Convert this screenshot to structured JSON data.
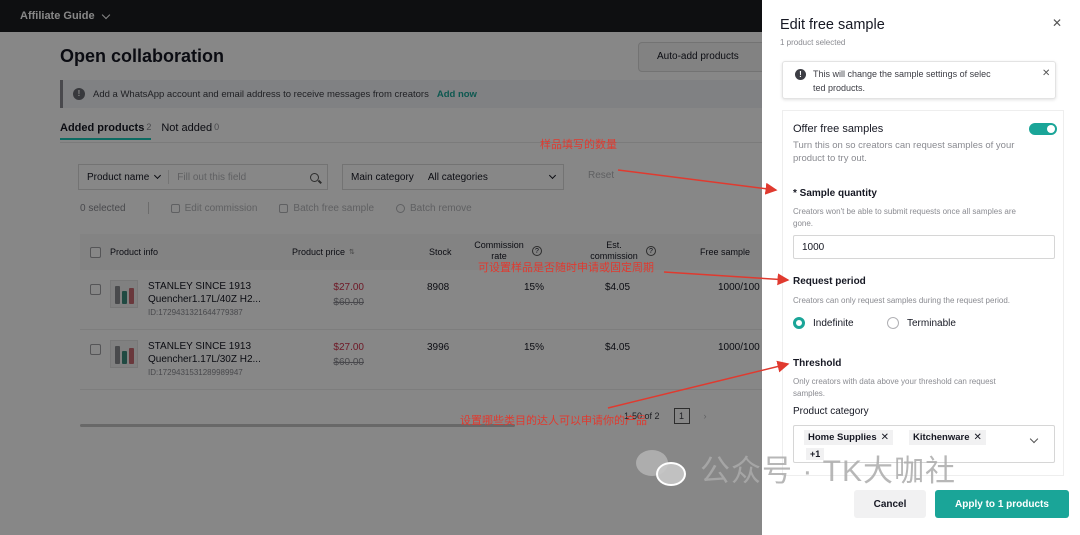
{
  "topbar": {
    "brand": "Affiliate Guide"
  },
  "main": {
    "title": "Open collaboration",
    "auto_add_label": "Auto-add products",
    "banner_text": "Add a WhatsApp account and email address to receive messages from creators",
    "banner_link": "Add now",
    "tabs": [
      {
        "label": "Added products",
        "count": "2"
      },
      {
        "label": "Not added",
        "count": "0"
      }
    ],
    "filter": {
      "product_name_label": "Product name",
      "product_name_placeholder": "Fill out this field",
      "category_label": "Main category",
      "category_value": "All categories",
      "reset_label": "Reset"
    },
    "actions": {
      "selected": "0 selected",
      "edit_commission": "Edit commission",
      "batch_free_sample": "Batch free sample",
      "batch_remove": "Batch remove"
    },
    "table": {
      "columns": {
        "product_info": "Product info",
        "product_price": "Product price",
        "stock": "Stock",
        "commission_rate_l1": "Commission",
        "commission_rate_l2": "rate",
        "est_commission_l1": "Est.",
        "est_commission_l2": "commission",
        "free_sample": "Free sample"
      },
      "rows": [
        {
          "name_l1": "STANLEY SINCE 1913",
          "name_l2": "Quencher1.17L/40Z H2...",
          "id": "ID:1729431321644779387",
          "price": "$27.00",
          "old_price": "$60.00",
          "stock": "8908",
          "commission": "15%",
          "est_commission": "$4.05",
          "free_sample": "1000/100"
        },
        {
          "name_l1": "STANLEY SINCE 1913",
          "name_l2": "Quencher1.17L/30Z H2...",
          "id": "ID:1729431531289989947",
          "price": "$27.00",
          "old_price": "$60.00",
          "stock": "3996",
          "commission": "15%",
          "est_commission": "$4.05",
          "free_sample": "1000/100"
        }
      ]
    },
    "pagination": {
      "range": "1-50 of 2",
      "page": "1"
    }
  },
  "drawer": {
    "title": "Edit free sample",
    "subtitle": "1 product selected",
    "notice_l1": "This will change the sample settings of selec",
    "notice_l2": "ted products.",
    "offer_label": "Offer free samples",
    "offer_enabled": true,
    "offer_desc_l1": "Turn this on so creators can request samples of your",
    "offer_desc_l2": "product to try out.",
    "sample_quantity": {
      "title": "* Sample quantity",
      "desc_l1": "Creators won't be able to submit requests once all samples are",
      "desc_l2": "gone.",
      "value": "1000"
    },
    "request_period": {
      "title": "Request period",
      "desc": "Creators can only request samples during the request period.",
      "options": [
        "Indefinite",
        "Terminable"
      ],
      "selected": "Indefinite"
    },
    "threshold": {
      "title": "Threshold",
      "desc_l1": "Only creators with data above your threshold can request",
      "desc_l2": "samples.",
      "category_label": "Product category",
      "tags": [
        "Home Supplies",
        "Kitchenware"
      ],
      "more": "+1"
    },
    "cancel_label": "Cancel",
    "apply_label": "Apply to 1 products"
  },
  "annotations": {
    "a1": "样品填写的数量",
    "a2": "可设置样品是否随时申请或固定周期",
    "a3": "设置哪些类目的达人可以申请你的产品"
  },
  "watermark": {
    "text": "公众号 · TK大咖社"
  },
  "colors": {
    "accent": "#1aa598",
    "annotation": "#e03a2f",
    "price": "#d0314a"
  }
}
